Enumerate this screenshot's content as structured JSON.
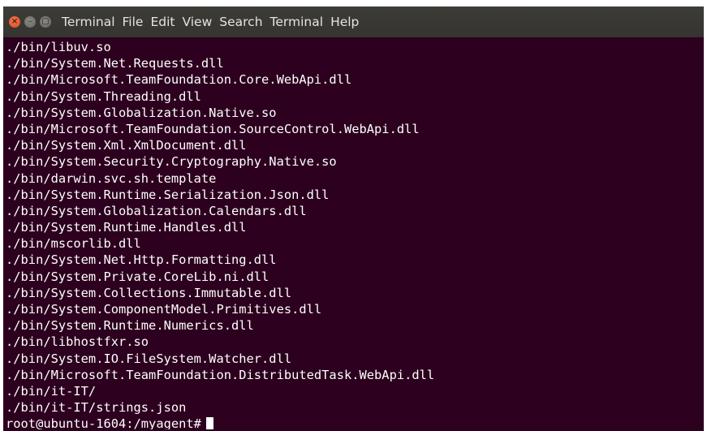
{
  "window": {
    "menu": [
      "Terminal",
      "File",
      "Edit",
      "View",
      "Search",
      "Terminal",
      "Help"
    ]
  },
  "terminal": {
    "lines": [
      "./bin/libuv.so",
      "./bin/System.Net.Requests.dll",
      "./bin/Microsoft.TeamFoundation.Core.WebApi.dll",
      "./bin/System.Threading.dll",
      "./bin/System.Globalization.Native.so",
      "./bin/Microsoft.TeamFoundation.SourceControl.WebApi.dll",
      "./bin/System.Xml.XmlDocument.dll",
      "./bin/System.Security.Cryptography.Native.so",
      "./bin/darwin.svc.sh.template",
      "./bin/System.Runtime.Serialization.Json.dll",
      "./bin/System.Globalization.Calendars.dll",
      "./bin/System.Runtime.Handles.dll",
      "./bin/mscorlib.dll",
      "./bin/System.Net.Http.Formatting.dll",
      "./bin/System.Private.CoreLib.ni.dll",
      "./bin/System.Collections.Immutable.dll",
      "./bin/System.ComponentModel.Primitives.dll",
      "./bin/System.Runtime.Numerics.dll",
      "./bin/libhostfxr.so",
      "./bin/System.IO.FileSystem.Watcher.dll",
      "./bin/Microsoft.TeamFoundation.DistributedTask.WebApi.dll",
      "./bin/it-IT/",
      "./bin/it-IT/strings.json"
    ],
    "prompt": "root@ubuntu-1604:/myagent#"
  },
  "colors": {
    "background": "#2c001e",
    "text": "#ffffff",
    "titlebar": "#3c3b37",
    "close_button": "#e95420"
  },
  "icons": [
    "close-icon",
    "minimize-icon",
    "maximize-icon"
  ]
}
